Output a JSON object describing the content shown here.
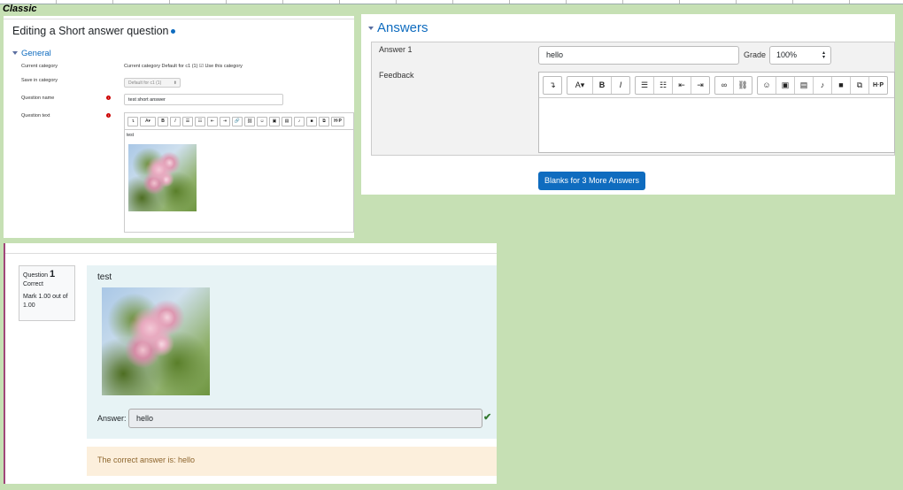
{
  "header_tag": "Classic",
  "editor": {
    "title": "Editing a Short answer question",
    "section": "General",
    "fields": {
      "current_category_label": "Current category",
      "current_category_value": "Current category  Default for c1 (1)  ☑ Use this category",
      "save_in_category_label": "Save in category",
      "save_in_category_value": "Default for c1 (1)",
      "question_name_label": "Question name",
      "question_name_value": "test short answer",
      "question_text_label": "Question text",
      "question_text_value": "test"
    }
  },
  "answers": {
    "heading": "Answers",
    "answer1_label": "Answer 1",
    "answer1_value": "hello",
    "grade_label": "Grade",
    "grade_value": "100%",
    "feedback_label": "Feedback",
    "blanks_button": "Blanks for 3 More Answers"
  },
  "preview": {
    "question_label": "Question",
    "question_number": "1",
    "state": "Correct",
    "mark": "Mark 1.00 out of 1.00",
    "question_text": "test",
    "answer_label": "Answer:",
    "answer_value": "hello",
    "correct_feedback": "The correct answer is: hello"
  },
  "toolbar_icons": [
    "paragraph-icon",
    "font-color-icon",
    "bold-icon",
    "italic-icon",
    "bullet-list-icon",
    "numbered-list-icon",
    "outdent-icon",
    "indent-icon",
    "link-icon",
    "unlink-icon",
    "emoji-icon",
    "image-icon",
    "media-icon",
    "record-audio-icon",
    "record-video-icon",
    "manage-files-icon",
    "h5p-icon"
  ],
  "colors": {
    "accent": "#0f6cbf",
    "correct": "#357a32",
    "feedback_bg": "#fcefdc",
    "question_bg": "#e7f3f5"
  }
}
